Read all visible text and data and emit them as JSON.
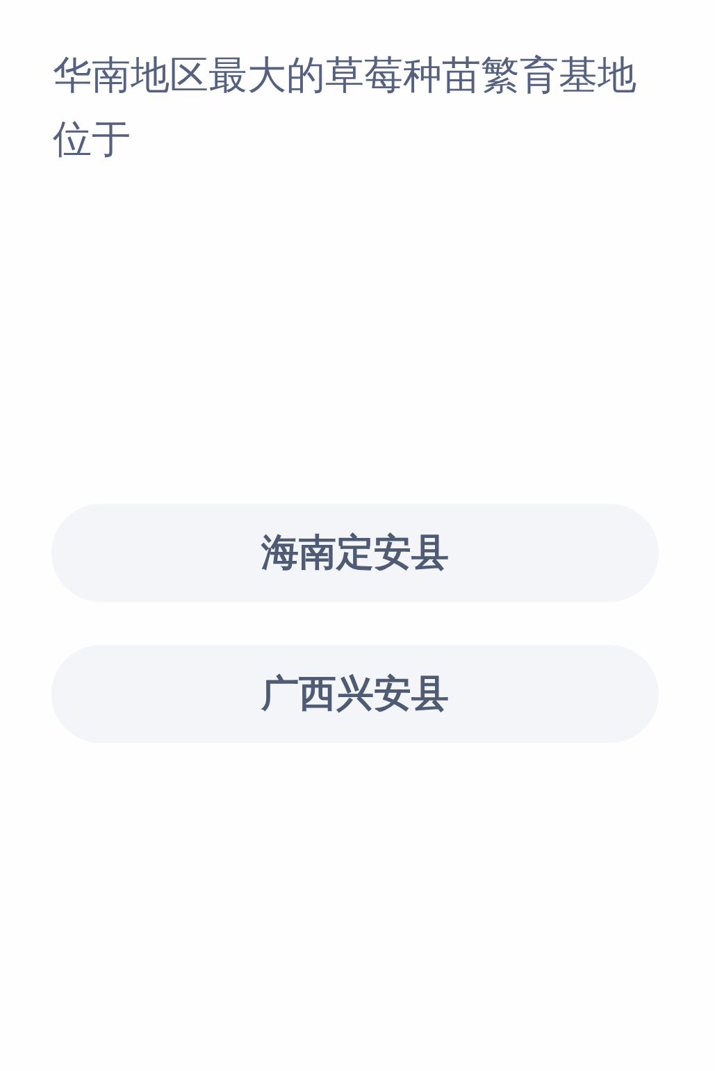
{
  "question": "华南地区最大的草莓种苗繁育基地位于",
  "options": [
    {
      "label": "海南定安县"
    },
    {
      "label": "广西兴安县"
    }
  ]
}
